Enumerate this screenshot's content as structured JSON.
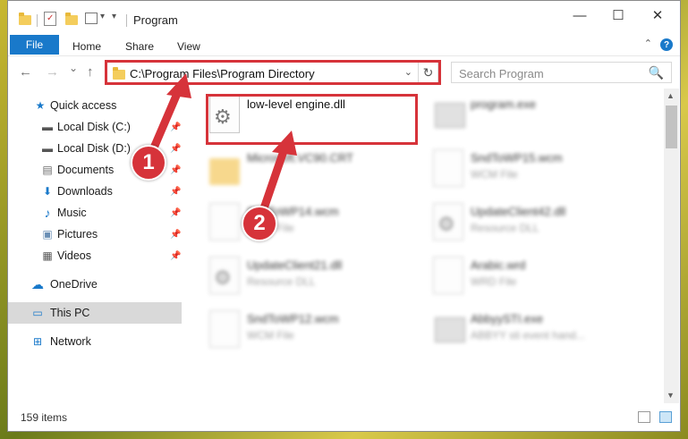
{
  "window": {
    "title": "Program",
    "controls": {
      "minimize": "—",
      "maximize": "☐",
      "close": "✕"
    }
  },
  "ribbon": {
    "tabs": [
      "File",
      "Home",
      "Share",
      "View"
    ],
    "help": "?",
    "collapse": "⌃"
  },
  "nav": {
    "back": "←",
    "forward": "→",
    "recent": "⌄",
    "up": "↑",
    "address": "C:\\Program Files\\Program Directory",
    "address_dropdown": "⌄",
    "refresh": "↻",
    "search_placeholder": "Search Program",
    "search_icon": "🔍"
  },
  "sidebar": {
    "items": [
      {
        "label": "Quick access",
        "icon": "star-icon",
        "glyph": "★",
        "color": "#1979ca",
        "pinned": false
      },
      {
        "label": "Local Disk (C:)",
        "icon": "drive-icon",
        "glyph": "▬",
        "color": "#555555",
        "pinned": true
      },
      {
        "label": "Local Disk (D:)",
        "icon": "drive-icon",
        "glyph": "▬",
        "color": "#555555",
        "pinned": true
      },
      {
        "label": "Documents",
        "icon": "documents-icon",
        "glyph": "▤",
        "color": "#6b6b6b",
        "pinned": true
      },
      {
        "label": "Downloads",
        "icon": "downloads-icon",
        "glyph": "⬇",
        "color": "#1979ca",
        "pinned": true
      },
      {
        "label": "Music",
        "icon": "music-icon",
        "glyph": "♪",
        "color": "#1979ca",
        "pinned": true
      },
      {
        "label": "Pictures",
        "icon": "pictures-icon",
        "glyph": "▣",
        "color": "#6a8fb5",
        "pinned": true
      },
      {
        "label": "Videos",
        "icon": "videos-icon",
        "glyph": "▦",
        "color": "#555555",
        "pinned": true
      },
      {
        "label": "OneDrive",
        "icon": "onedrive-icon",
        "glyph": "☁",
        "color": "#1979ca",
        "pinned": false
      },
      {
        "label": "This PC",
        "icon": "this-pc-icon",
        "glyph": "▭",
        "color": "#1979ca",
        "pinned": false,
        "selected": true
      },
      {
        "label": "Network",
        "icon": "network-icon",
        "glyph": "⊞",
        "color": "#1979ca",
        "pinned": false
      }
    ],
    "pin_glyph": "📌"
  },
  "files": [
    {
      "name": "low-level engine.dll",
      "type": "",
      "icon": "dll"
    },
    {
      "name": "program.exe",
      "type": "",
      "icon": "exe"
    },
    {
      "name": "Microsoft.VC90.CRT",
      "type": "",
      "icon": "folder"
    },
    {
      "name": "SndToWP15.wcm",
      "type": "WCM File",
      "icon": "file"
    },
    {
      "name": "SndToWP14.wcm",
      "type": "WCM File",
      "icon": "file"
    },
    {
      "name": "UpdateClient42.dll",
      "type": "Resource DLL",
      "icon": "dll"
    },
    {
      "name": "UpdateClient21.dll",
      "type": "Resource DLL",
      "icon": "dll"
    },
    {
      "name": "Arabic.wrd",
      "type": "WRD File",
      "icon": "file"
    },
    {
      "name": "SndToWP12.wcm",
      "type": "WCM File",
      "icon": "file"
    },
    {
      "name": "AbbyySTI.exe",
      "type": "ABBYY sti event hand...",
      "icon": "exe"
    }
  ],
  "status": {
    "item_count": "159 items"
  },
  "callouts": [
    "1",
    "2"
  ],
  "colors": {
    "accent": "#1979ca",
    "callout": "#d6333a"
  }
}
